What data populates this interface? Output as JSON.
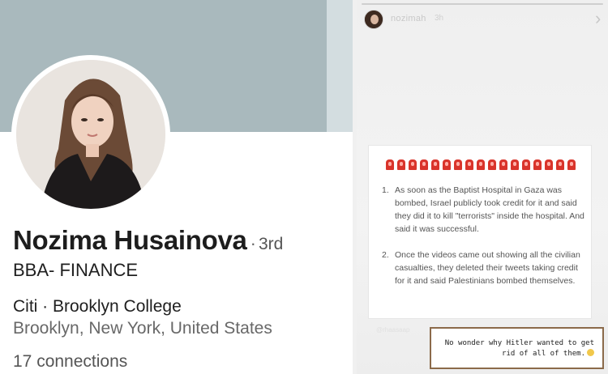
{
  "profile": {
    "name": "Nozima Husainova",
    "separator": "·",
    "degree": "3rd",
    "headline": "BBA- FINANCE",
    "company": "Citi · Brooklyn College",
    "location": "Brooklyn, New York, United States",
    "connections": "17 connections",
    "banner_color": "#a9b9bd"
  },
  "story": {
    "username": "nozimah",
    "time": "3h",
    "next_icon": "chevron-right-icon",
    "card": {
      "alarm_emoji_icon": "police-light-icon",
      "items": [
        {
          "number": "1.",
          "text": "As soon as the Baptist Hospital in Gaza was bombed, Israel publicly took credit for it and said they did it to kill \"terrorists\" inside the hospital. And said it was successful."
        },
        {
          "number": "2.",
          "text": "Once the videos came out showing all the civilian casualties, they deleted their tweets taking credit for it and said Palestinians bombed themselves."
        }
      ]
    },
    "source_handle": "@rhaasaap",
    "comment": "No wonder why Hitler wanted to get rid of all of them.",
    "comment_emoji": "grinning-face-icon",
    "accent_border": "#8b6a4a"
  }
}
